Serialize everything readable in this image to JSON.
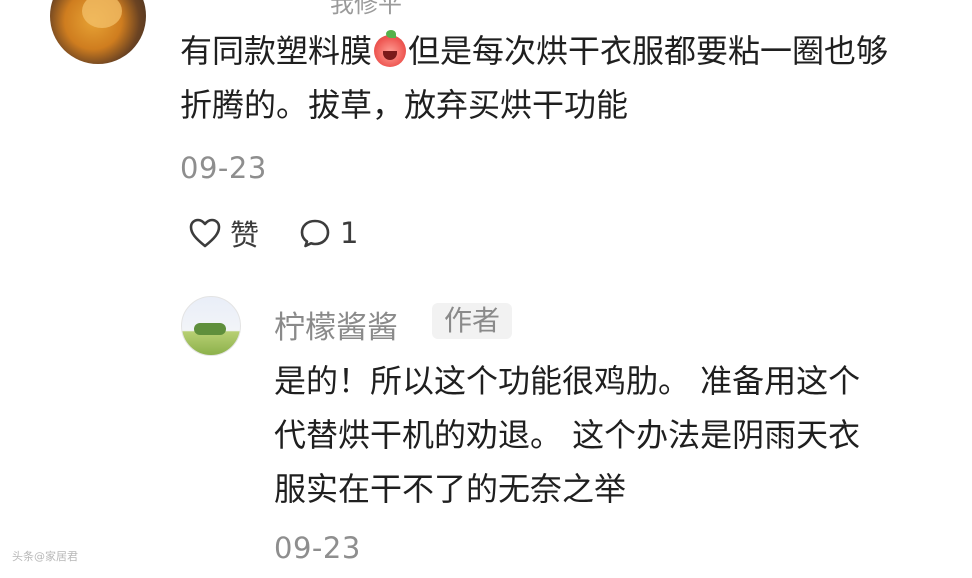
{
  "top_comment": {
    "cut_off_username": "我修平",
    "text_before_emoji": "有同款塑料膜",
    "emoji": "laughing-tomato-emoji",
    "text_after_emoji": "但是每次烘干衣服都要粘一圈也够折腾的。拔草，放弃买烘干功能",
    "date": "09-23",
    "like_label": "赞",
    "comment_count": "1"
  },
  "reply": {
    "username": "柠檬酱酱",
    "author_badge": "作者",
    "text": "是的！所以这个功能很鸡肋。 准备用这个代替烘干机的劝退。 这个办法是阴雨天衣服实在干不了的无奈之举",
    "date": "09-23"
  },
  "watermark": "头条@家居君"
}
